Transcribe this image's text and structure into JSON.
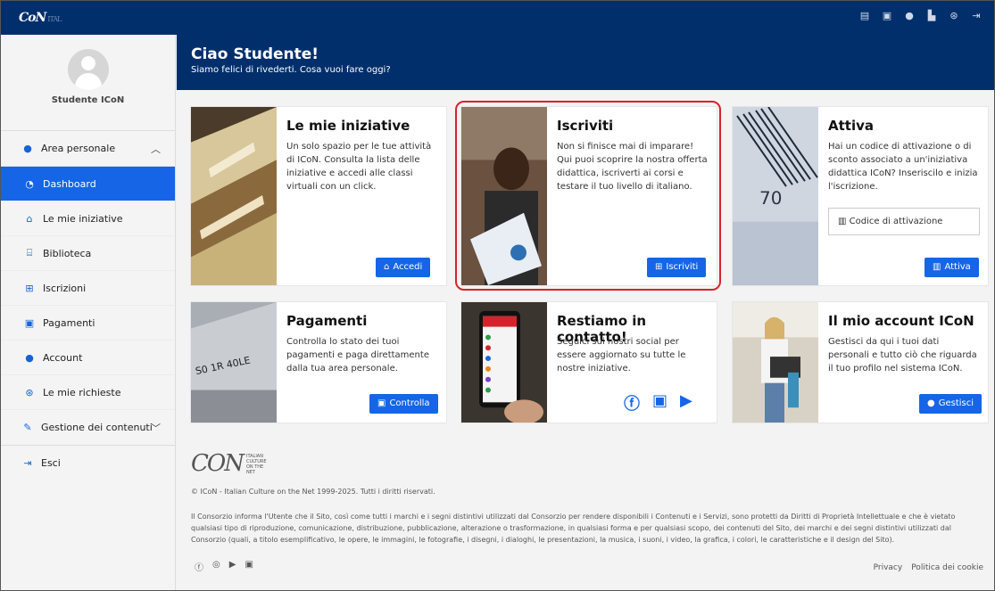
{
  "topbar": {
    "logo_text": "CoN",
    "logo_sub": "ITAL",
    "icons": [
      "newspaper-icon",
      "id-card-icon",
      "user-icon",
      "building-icon",
      "help-icon",
      "logout-icon"
    ]
  },
  "sidebar": {
    "profile_name": "Studente ICoN",
    "groups": [
      {
        "label": "Area personale",
        "expanded": true
      },
      {
        "label": "Gestione dei contenuti",
        "expanded": false
      }
    ],
    "items": [
      {
        "label": "Dashboard",
        "icon": "dashboard-icon",
        "active": true
      },
      {
        "label": "Le mie iniziative",
        "icon": "graduation-cap-icon"
      },
      {
        "label": "Biblioteca",
        "icon": "library-icon"
      },
      {
        "label": "Iscrizioni",
        "icon": "cart-icon"
      },
      {
        "label": "Pagamenti",
        "icon": "money-icon"
      },
      {
        "label": "Account",
        "icon": "user-cog-icon"
      },
      {
        "label": "Le mie richieste",
        "icon": "lifering-icon"
      },
      {
        "label": "Esci",
        "icon": "logout-icon"
      }
    ]
  },
  "hero": {
    "title": "Ciao Studente!",
    "subtitle": "Siamo felici di rivederti. Cosa vuoi fare oggi?"
  },
  "cards": {
    "iniziative": {
      "title": "Le mie iniziative",
      "desc": "Un solo spazio per le tue attività di ICoN. Consulta la lista delle iniziative e accedi alle classi virtuali con un click.",
      "button": "Accedi"
    },
    "iscriviti": {
      "title": "Iscriviti",
      "desc": "Non si finisce mai di imparare! Qui puoi scoprire la nostra offerta didattica, iscriverti ai corsi e testare il tuo livello di italiano.",
      "button": "Iscriviti"
    },
    "attiva": {
      "title": "Attiva",
      "desc": "Hai un codice di attivazione o di sconto associato a un'iniziativa didattica ICoN? Inseriscilo e inizia l'iscrizione.",
      "input_placeholder": "Codice di attivazione",
      "button": "Attiva"
    },
    "pagamenti": {
      "title": "Pagamenti",
      "desc": "Controlla lo stato dei tuoi pagamenti e paga direttamente dalla tua area personale.",
      "button": "Controlla"
    },
    "contatto": {
      "title": "Restiamo in contatto!",
      "desc": "Seguici sui nostri social per essere aggiornato su tutte le nostre iniziative.",
      "social": [
        "facebook-icon",
        "linkedin-icon",
        "youtube-icon"
      ]
    },
    "account": {
      "title": "Il mio account ICoN",
      "desc": "Gestisci da qui i tuoi dati personali e tutto ciò che riguarda il tuo profilo nel sistema ICoN.",
      "button": "Gestisci"
    }
  },
  "footer": {
    "logo_text": "CON",
    "logo_tag": "ITALIAN CULTURE ON THE NET",
    "copyright": "© ICoN - Italian Culture on the Net 1999-2025. Tutti i diritti riservati.",
    "legal": "Il Consorzio informa l'Utente che il Sito, così come tutti i marchi e i segni distintivi utilizzati dal Consorzio per rendere disponibili i Contenuti e i Servizi, sono protetti da Diritti di Proprietà Intellettuale e che è vietato qualsiasi tipo di riproduzione, comunicazione, distribuzione, pubblicazione, alterazione o trasformazione, in qualsiasi forma e per qualsiasi scopo, dei contenuti del Sito, dei marchi e dei segni distintivi utilizzati dal Consorzio (quali, a titolo esemplificativo, le opere, le immagini, le fotografie, i disegni, i dialoghi, le presentazioni, la musica, i suoni, i video, la grafica, i colori, le caratteristiche e il design del Sito).",
    "social": [
      "facebook-icon",
      "instagram-icon",
      "youtube-icon",
      "linkedin-icon"
    ],
    "links": [
      "Privacy",
      "Politica dei cookie"
    ]
  },
  "colors": {
    "navy": "#002f6c",
    "accent": "#1565e6",
    "highlight": "#d6232b"
  }
}
